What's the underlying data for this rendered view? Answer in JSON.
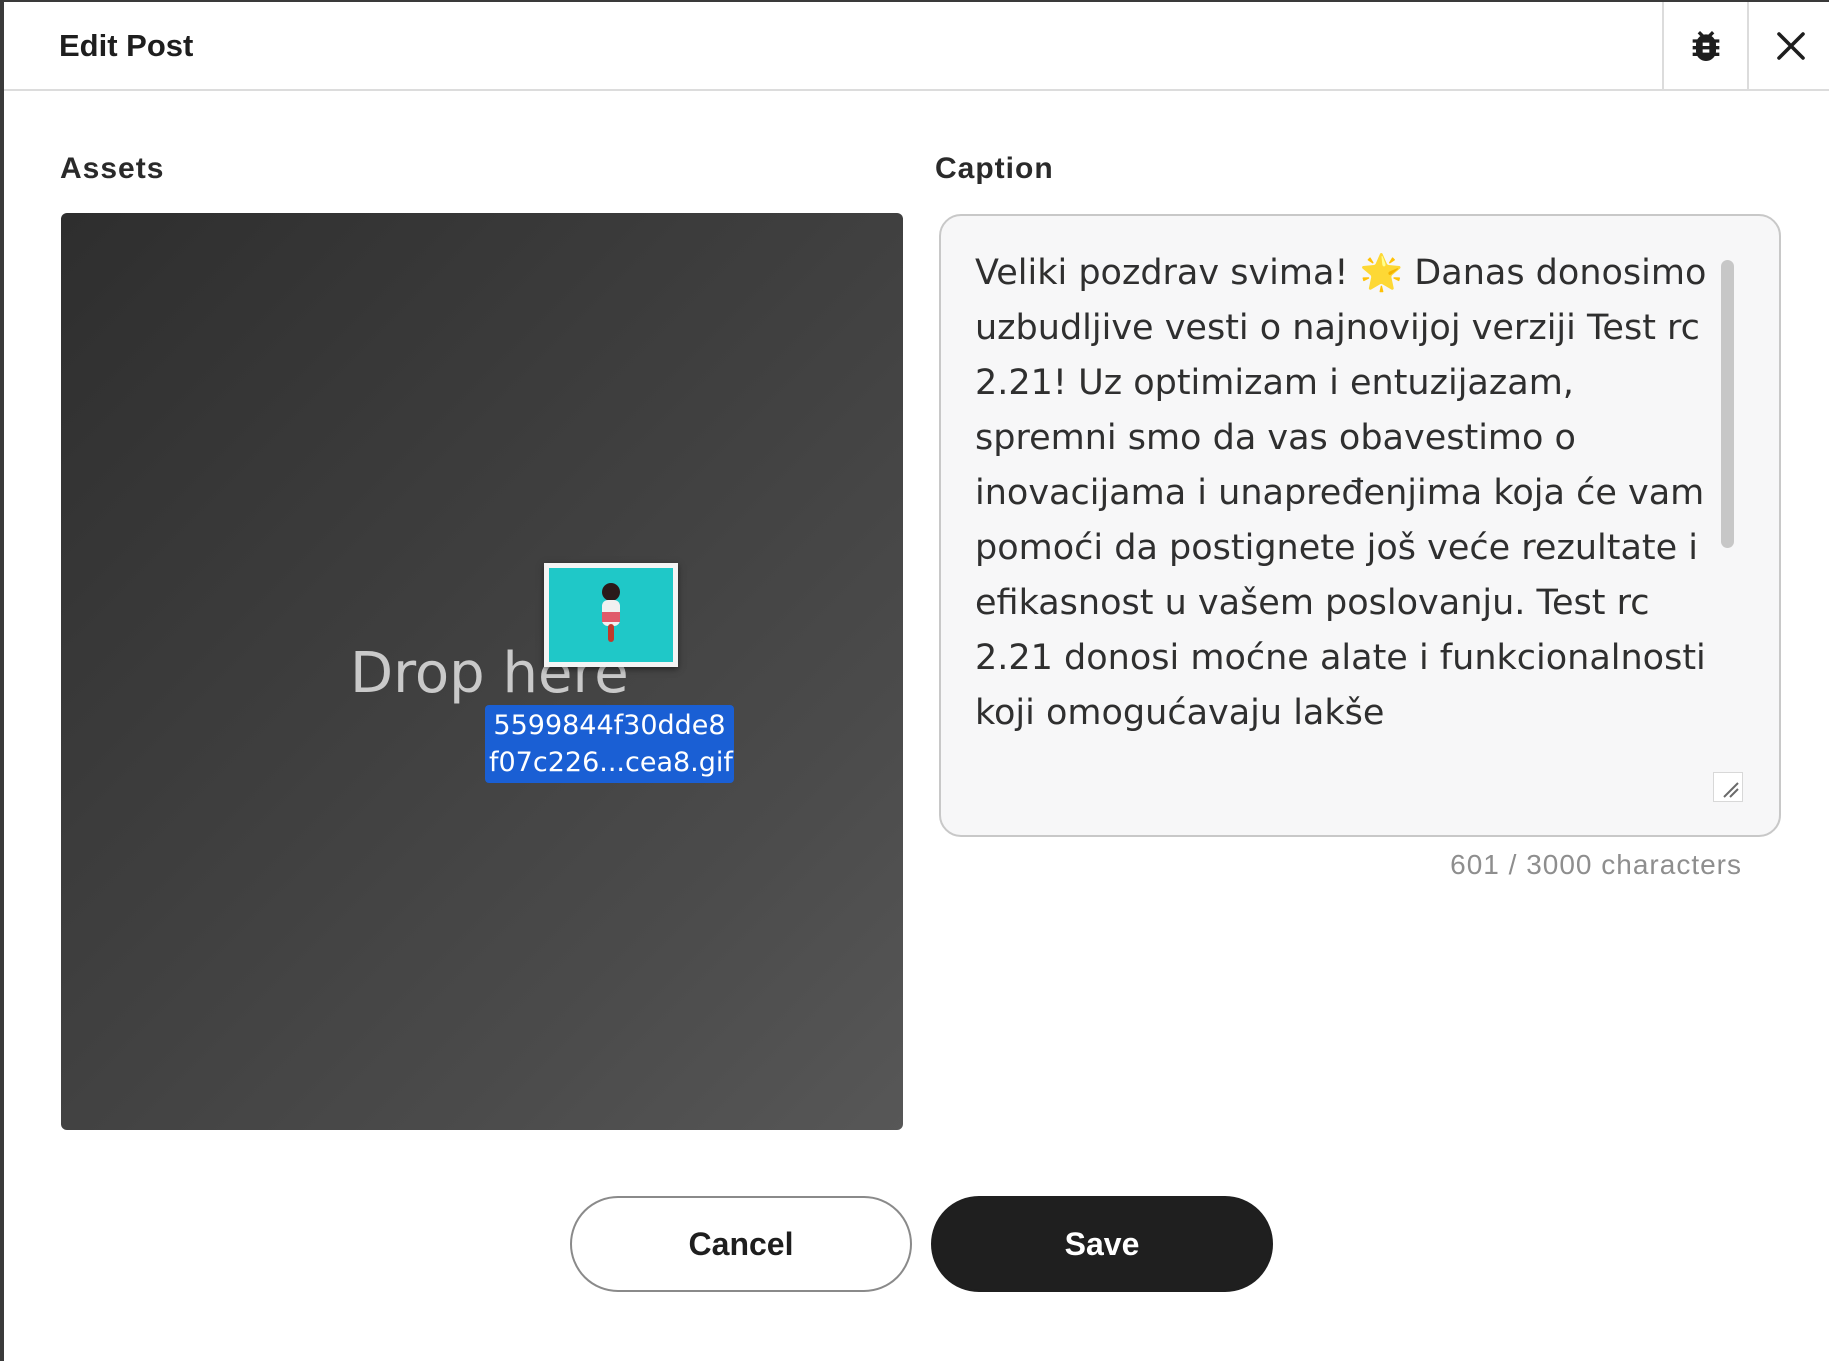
{
  "header": {
    "title": "Edit Post",
    "debug_icon": "bug-icon",
    "close_icon": "close-icon"
  },
  "assets": {
    "label": "Assets",
    "drop_text": "Drop here",
    "dragged_file": {
      "name_line1": "5599844f30dde8",
      "name_line2": "f07c226...cea8.gif",
      "thumb_color": "#1fc8c8"
    }
  },
  "caption": {
    "label": "Caption",
    "text": "Veliki pozdrav svima! 🌟 Danas donosimo uzbudljive vesti o najnovijoj verziji Test rc 2.21! Uz optimizam i entuzijazam, spremni smo da vas obavestimo o inovacijama i unapređenjima koja će vam pomoći da postignete još veće rezultate i efikasnost u vašem poslovanju. Test rc 2.21 donosi moćne alate i funkcionalnosti koji omogućavaju lakše",
    "char_count": "601 / 3000 characters"
  },
  "actions": {
    "cancel_label": "Cancel",
    "save_label": "Save"
  },
  "colors": {
    "save_bg": "#1f1f1f",
    "drag_highlight": "#1a5fd4"
  }
}
